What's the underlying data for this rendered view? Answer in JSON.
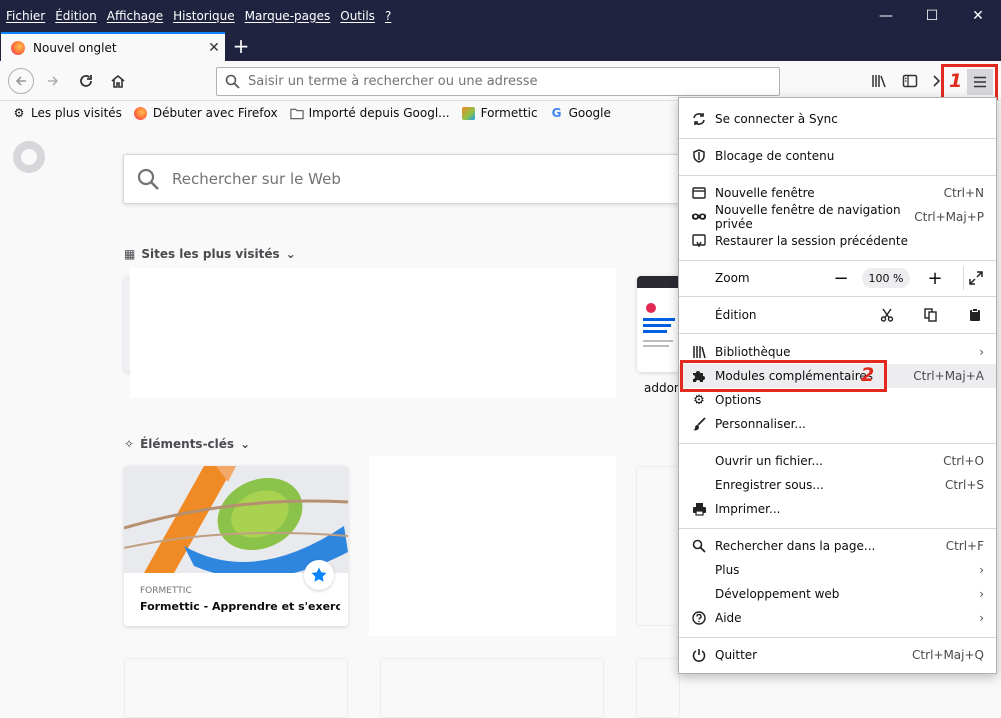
{
  "menubar": [
    "Fichier",
    "Édition",
    "Affichage",
    "Historique",
    "Marque-pages",
    "Outils",
    "?"
  ],
  "window_controls": {
    "minimize": "—",
    "maximize": "☐",
    "close": "✕"
  },
  "tab": {
    "title": "Nouvel onglet",
    "close": "✕",
    "new_tab": "+"
  },
  "urlbar": {
    "placeholder": "Saisir un terme à rechercher ou une adresse"
  },
  "bookmarks": [
    "Les plus visités",
    "Débuter avec Firefox",
    "Importé depuis Googl...",
    "Formettic",
    "Google"
  ],
  "content": {
    "search_placeholder": "Rechercher sur le Web",
    "top_sites_title": "Sites les plus visités",
    "top_site_label": "addon",
    "highlights_title": "Éléments-clés",
    "card_source": "FORMETTIC",
    "card_title": "Formettic - Apprendre et s'exercer..."
  },
  "annotations": {
    "one": "1",
    "two": "2"
  },
  "menu": {
    "sync": "Se connecter à Sync",
    "blocking": "Blocage de contenu",
    "new_window": {
      "label": "Nouvelle fenêtre",
      "shortcut": "Ctrl+N"
    },
    "private_window": {
      "label": "Nouvelle fenêtre de navigation privée",
      "shortcut": "Ctrl+Maj+P"
    },
    "restore": "Restaurer la session précédente",
    "zoom": {
      "label": "Zoom",
      "level": "100 %"
    },
    "edit": "Édition",
    "library": "Bibliothèque",
    "addons": {
      "label": "Modules complémentaires",
      "shortcut": "Ctrl+Maj+A"
    },
    "options": "Options",
    "customize": "Personnaliser...",
    "open_file": {
      "label": "Ouvrir un fichier...",
      "shortcut": "Ctrl+O"
    },
    "save_as": {
      "label": "Enregistrer sous...",
      "shortcut": "Ctrl+S"
    },
    "print": "Imprimer...",
    "find": {
      "label": "Rechercher dans la page...",
      "shortcut": "Ctrl+F"
    },
    "more": "Plus",
    "webdev": "Développement web",
    "help": "Aide",
    "quit": {
      "label": "Quitter",
      "shortcut": "Ctrl+Maj+Q"
    }
  },
  "colors": {
    "titlebar": "#202340",
    "accent": "#0a84ff",
    "highlight_box": "#e2291d"
  }
}
